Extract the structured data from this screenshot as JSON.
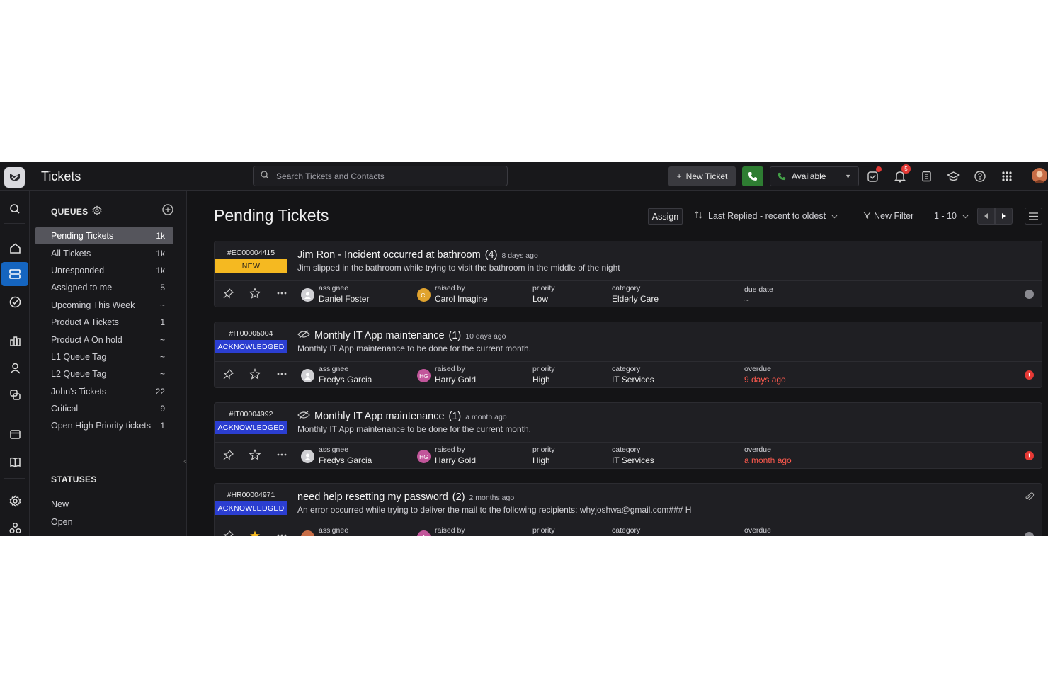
{
  "app": {
    "title": "Tickets"
  },
  "search": {
    "placeholder": "Search Tickets and Contacts"
  },
  "topbar": {
    "new_ticket_label": "New Ticket",
    "availability": "Available",
    "notifications_count": "5",
    "icons": [
      "tasks-icon",
      "bell-icon",
      "notes-icon",
      "learn-icon",
      "help-icon",
      "apps-grid-icon"
    ]
  },
  "rail": {
    "items": [
      "search-icon",
      "home-icon",
      "tickets-icon",
      "check-icon",
      "reports-icon",
      "contacts-icon",
      "chat-icon",
      "window-icon",
      "knowledge-icon",
      "settings-icon",
      "integrations-icon"
    ]
  },
  "sidebar": {
    "queues_heading": "QUEUES",
    "queues": [
      {
        "label": "Pending Tickets",
        "count": "1k"
      },
      {
        "label": "All Tickets",
        "count": "1k"
      },
      {
        "label": "Unresponded",
        "count": "1k"
      },
      {
        "label": "Assigned to me",
        "count": "5"
      },
      {
        "label": "Upcoming This Week",
        "count": "~"
      },
      {
        "label": "Product A Tickets",
        "count": "1"
      },
      {
        "label": "Product A On hold",
        "count": "~"
      },
      {
        "label": "L1 Queue Tag",
        "count": "~"
      },
      {
        "label": "L2 Queue Tag",
        "count": "~"
      },
      {
        "label": "John's Tickets",
        "count": "22"
      },
      {
        "label": "Critical",
        "count": "9"
      },
      {
        "label": "Open High Priority tickets",
        "count": "1"
      }
    ],
    "statuses_heading": "STATUSES",
    "statuses": [
      "New",
      "Open"
    ]
  },
  "main": {
    "title": "Pending Tickets",
    "assign_label": "Assign",
    "sort_label": "Last Replied - recent to oldest",
    "filter_label": "New Filter",
    "range_label": "1 - 10"
  },
  "labels": {
    "assignee": "assignee",
    "raised_by": "raised by",
    "priority": "priority",
    "category": "category"
  },
  "tickets": [
    {
      "id": "#EC00004415",
      "status": "NEW",
      "title": "Jim Ron - Incident occurred at bathroom",
      "count": "(4)",
      "ago": "8 days ago",
      "description": "Jim slipped in the bathroom while trying to visit the bathroom in the middle of the night",
      "assignee": "Daniel Foster",
      "raised_by": "Carol Imagine",
      "raised_initials": "CI",
      "priority": "Low",
      "category": "Elderly Care",
      "due_label": "due date",
      "due_value": "~"
    },
    {
      "id": "#IT00005004",
      "status": "ACKNOWLEDGED",
      "title": "Monthly IT App maintenance",
      "count": "(1)",
      "ago": "10 days ago",
      "description": "Monthly IT App maintenance to be done for the current month.",
      "assignee": "Fredys Garcia",
      "raised_by": "Harry Gold",
      "raised_initials": "HG",
      "priority": "High",
      "category": "IT Services",
      "due_label": "overdue",
      "due_value": "9 days ago"
    },
    {
      "id": "#IT00004992",
      "status": "ACKNOWLEDGED",
      "title": "Monthly IT App maintenance",
      "count": "(1)",
      "ago": "a month ago",
      "description": "Monthly IT App maintenance to be done for the current month.",
      "assignee": "Fredys Garcia",
      "raised_by": "Harry Gold",
      "raised_initials": "HG",
      "priority": "High",
      "category": "IT Services",
      "due_label": "overdue",
      "due_value": "a month ago"
    },
    {
      "id": "#HR00004971",
      "status": "ACKNOWLEDGED",
      "title": "need help resetting my password",
      "count": "(2)",
      "ago": "2 months ago",
      "description": "An error occurred while trying to deliver the mail to the following recipients: whyjoshwa@gmail.com### H",
      "raised_initials": "A",
      "due_label": "overdue"
    }
  ],
  "colors": {
    "accent": "#1565c0",
    "new_badge": "#f5b921",
    "ack_badge": "#2b3ed1",
    "overdue": "#ff5a4e",
    "phone": "#2e7d32"
  }
}
